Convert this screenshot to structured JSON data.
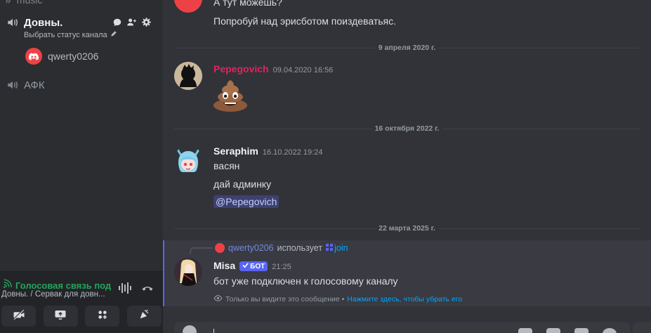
{
  "sidebar": {
    "cut_channel": "music",
    "active_channel": "Довны.",
    "active_channel_status": "Выбрать статус канала",
    "voice_user": "qwerty0206",
    "afk_channel": "АФК"
  },
  "voice_panel": {
    "status": "Голосовая связь под",
    "subtitle": "Довны. / Сервак для довн..."
  },
  "messages": {
    "prev_line1": "А тут можешь?",
    "prev_line2": "Попробуй над эрисботом поиздеватьяс.",
    "date1": "9 апреля 2020 г.",
    "m1": {
      "author": "Pepegovich",
      "time": "09.04.2020 16:56",
      "author_color": "#e0245e"
    },
    "date2": "16 октября 2022 г.",
    "m2": {
      "author": "Seraphim",
      "time": "16.10.2022 19:24",
      "line1": "васян",
      "line2": "дай админку",
      "mention": "@Pepegovich"
    },
    "date3": "22 марта 2025 г.",
    "m3": {
      "reply_user": "qwerty0206",
      "reply_uses": "использует",
      "reply_cmd": "join",
      "author": "Misa",
      "bot_tag": "БОТ",
      "time": "21:25",
      "text": "бот уже подключен к голосовому каналу",
      "ephemeral_text": "Только вы видите это сообщение •",
      "ephemeral_link": "Нажмите здесь, чтобы убрать его"
    }
  },
  "colors": {
    "accent": "#5865f2",
    "connected_green": "#23a55a",
    "link": "#00a8fc"
  }
}
